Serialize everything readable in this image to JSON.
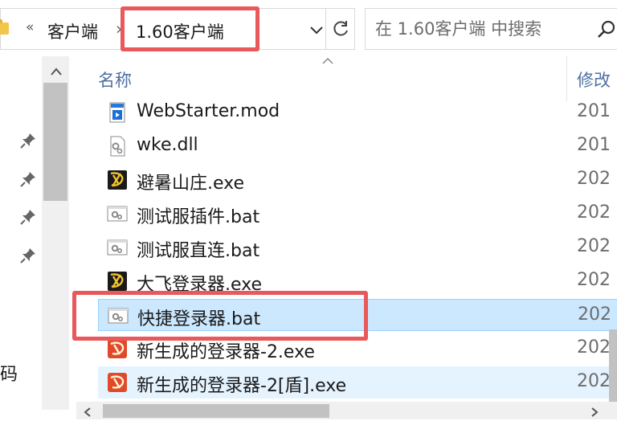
{
  "address_bar": {
    "breadcrumb": [
      "客户端",
      "1.60客户端"
    ],
    "overflow_glyph": "«"
  },
  "search": {
    "placeholder": "在 1.60客户端 中搜索"
  },
  "columns": {
    "name": "名称",
    "modified": "修改"
  },
  "files": [
    {
      "name": "WebStarter.mod",
      "modified": "201",
      "icon": "media-file-icon"
    },
    {
      "name": "wke.dll",
      "modified": "201",
      "icon": "gear-file-icon"
    },
    {
      "name": "避暑山庄.exe",
      "modified": "202",
      "icon": "game-app-icon"
    },
    {
      "name": "测试服插件.bat",
      "modified": "202",
      "icon": "batch-file-icon"
    },
    {
      "name": "测试服直连.bat",
      "modified": "202",
      "icon": "batch-file-icon"
    },
    {
      "name": "大飞登录器.exe",
      "modified": "202",
      "icon": "game-app-icon"
    },
    {
      "name": "快捷登录器.bat",
      "modified": "202",
      "icon": "batch-file-icon",
      "selected": true
    },
    {
      "name": "新生成的登录器-2.exe",
      "modified": "202",
      "icon": "launcher-app-icon"
    },
    {
      "name": "新生成的登录器-2[盾].exe",
      "modified": "202",
      "icon": "launcher-app-icon",
      "hover": true
    }
  ],
  "nav": {
    "partial_label": "码"
  },
  "colors": {
    "highlight": "#e9585a",
    "selection_bg": "#cce8ff",
    "selection_border": "#99d1ff",
    "header_text": "#4d6fa3"
  }
}
